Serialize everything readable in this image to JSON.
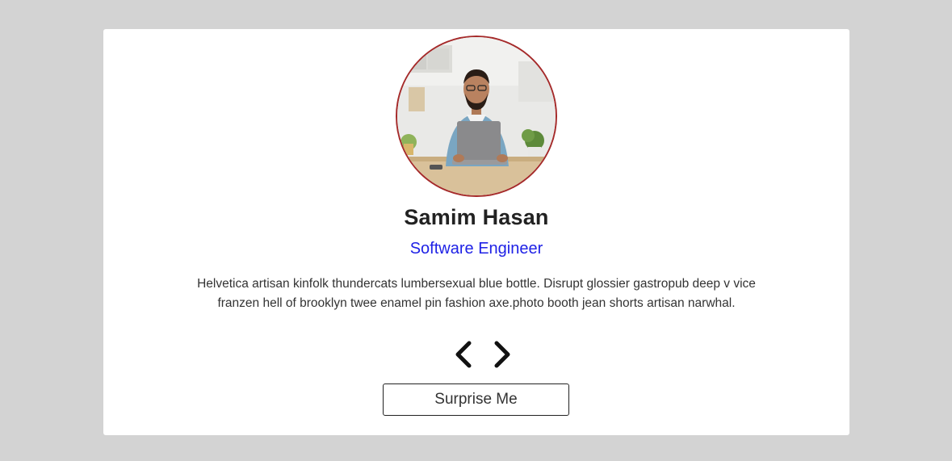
{
  "person": {
    "name": "Samim Hasan",
    "job": "Software Engineer",
    "text": "Helvetica artisan kinfolk thundercats lumbersexual blue bottle. Disrupt glossier gastropub deep v vice franzen hell of brooklyn twee enamel pin fashion axe.photo booth jean shorts artisan narwhal."
  },
  "controls": {
    "prev_icon": "chevron-left-icon",
    "next_icon": "chevron-right-icon",
    "surprise_label": "Surprise Me"
  },
  "colors": {
    "page_background": "#d3d3d3",
    "card_background": "#ffffff",
    "avatar_border": "#a52a2a",
    "job_color": "#1f22e6",
    "name_color": "#222222"
  }
}
